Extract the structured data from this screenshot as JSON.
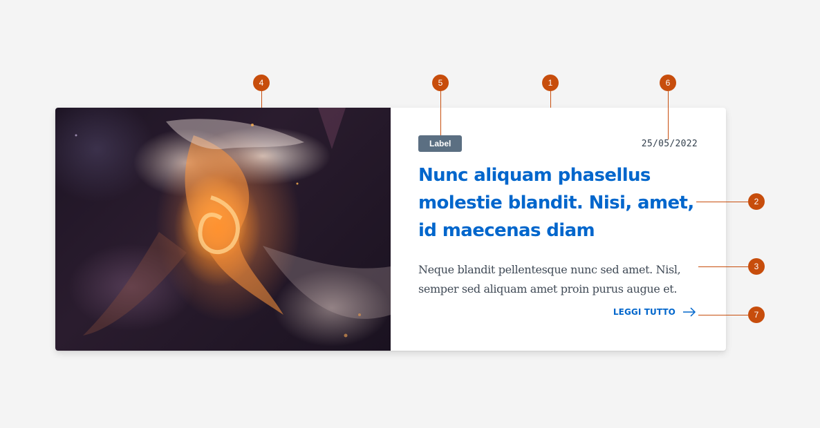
{
  "card": {
    "label": "Label",
    "date": "25/05/2022",
    "title": "Nunc aliquam phasellus molestie blandit. Nisi, amet, id maecenas diam",
    "description": "Neque blandit pellentesque nunc sed amet. Nisl, semper sed aliquam amet proin purus augue et.",
    "read_more": "LEGGI TUTTO",
    "read_more_icon": "arrow-right-icon",
    "image_subject": "abstract fluid ink art",
    "colors": {
      "title": "#0066cc",
      "link": "#0066cc",
      "badge_bg": "#5b6f82",
      "text": "#404a56",
      "annotation": "#c74d0c",
      "page_bg": "#f4f4f4"
    }
  },
  "annotations": {
    "m1": "1",
    "m2": "2",
    "m3": "3",
    "m4": "4",
    "m5": "5",
    "m6": "6",
    "m7": "7"
  }
}
